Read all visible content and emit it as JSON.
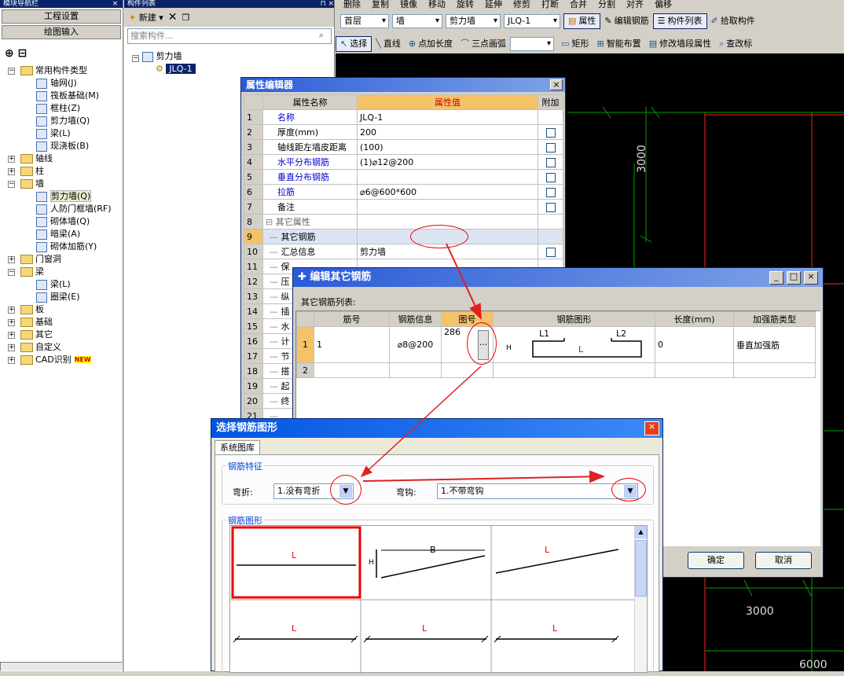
{
  "nav": {
    "title": "模块导航栏",
    "btn_project": "工程设置",
    "btn_draw": "绘图输入",
    "tree": [
      {
        "label": "常用构件类型",
        "level": 0,
        "type": "folder",
        "exp": "-"
      },
      {
        "label": "轴网(J)",
        "level": 1,
        "type": "item"
      },
      {
        "label": "筏板基础(M)",
        "level": 1,
        "type": "item"
      },
      {
        "label": "框柱(Z)",
        "level": 1,
        "type": "item"
      },
      {
        "label": "剪力墙(Q)",
        "level": 1,
        "type": "item"
      },
      {
        "label": "梁(L)",
        "level": 1,
        "type": "item"
      },
      {
        "label": "现浇板(B)",
        "level": 1,
        "type": "item"
      },
      {
        "label": "轴线",
        "level": 0,
        "type": "folder",
        "exp": "+"
      },
      {
        "label": "柱",
        "level": 0,
        "type": "folder",
        "exp": "+"
      },
      {
        "label": "墙",
        "level": 0,
        "type": "folder",
        "exp": "-"
      },
      {
        "label": "剪力墙(Q)",
        "level": 1,
        "type": "item",
        "sel": true
      },
      {
        "label": "人防门框墙(RF)",
        "level": 1,
        "type": "item"
      },
      {
        "label": "砌体墙(Q)",
        "level": 1,
        "type": "item"
      },
      {
        "label": "暗梁(A)",
        "level": 1,
        "type": "item"
      },
      {
        "label": "砌体加筋(Y)",
        "level": 1,
        "type": "item"
      },
      {
        "label": "门窗洞",
        "level": 0,
        "type": "folder",
        "exp": "+"
      },
      {
        "label": "梁",
        "level": 0,
        "type": "folder",
        "exp": "-"
      },
      {
        "label": "梁(L)",
        "level": 1,
        "type": "item"
      },
      {
        "label": "圈梁(E)",
        "level": 1,
        "type": "item"
      },
      {
        "label": "板",
        "level": 0,
        "type": "folder",
        "exp": "+"
      },
      {
        "label": "基础",
        "level": 0,
        "type": "folder",
        "exp": "+"
      },
      {
        "label": "其它",
        "level": 0,
        "type": "folder",
        "exp": "+"
      },
      {
        "label": "自定义",
        "level": 0,
        "type": "folder",
        "exp": "+"
      },
      {
        "label": "CAD识别",
        "level": 0,
        "type": "folder",
        "exp": "+",
        "badge": "NEW"
      }
    ]
  },
  "clist": {
    "title": "构件列表",
    "new_label": "新建",
    "search_placeholder": "搜索构件...",
    "root": "剪力墙",
    "child": "JLQ-1"
  },
  "toolbar0": [
    "删除",
    "复制",
    "镜像",
    "移动",
    "旋转",
    "延伸",
    "修剪",
    "打断",
    "合并",
    "分割",
    "对齐",
    "偏移"
  ],
  "toolbar1": {
    "floor": "首层",
    "cat": "墙",
    "type": "剪力墙",
    "comp": "JLQ-1",
    "btn_prop": "属性",
    "btn_edit": "编辑钢筋",
    "btn_list": "构件列表",
    "btn_pick": "拾取构件"
  },
  "toolbar2": [
    "选择",
    "直线",
    "点加长度",
    "三点画弧",
    "矩形",
    "智能布置",
    "修改墙段属性",
    "查改标"
  ],
  "cad": {
    "dim1": "3000",
    "dim2": "3000",
    "dim3": "6000"
  },
  "prop": {
    "title": "属性编辑器",
    "h_name": "属性名称",
    "h_val": "属性值",
    "h_add": "附加",
    "rows": [
      {
        "n": "1",
        "name": "名称",
        "val": "JLQ-1",
        "blue": true,
        "cb": false
      },
      {
        "n": "2",
        "name": "厚度(mm)",
        "val": "200",
        "blue": false,
        "cb": true
      },
      {
        "n": "3",
        "name": "轴线距左墙皮距离",
        "val": "(100)",
        "blue": false,
        "cb": true
      },
      {
        "n": "4",
        "name": "水平分布钢筋",
        "val": "(1)⌀12@200",
        "blue": true,
        "cb": true
      },
      {
        "n": "5",
        "name": "垂直分布钢筋",
        "val": "",
        "blue": true,
        "cb": true
      },
      {
        "n": "6",
        "name": "拉筋",
        "val": "⌀6@600*600",
        "blue": true,
        "cb": true
      },
      {
        "n": "7",
        "name": "备注",
        "val": "",
        "blue": false,
        "cb": true
      },
      {
        "n": "8",
        "name": "其它属性",
        "val": "",
        "blue": false,
        "cb": false,
        "group": true
      },
      {
        "n": "9",
        "name": "其它钢筋",
        "val": "",
        "blue": false,
        "cb": false,
        "sel": true
      },
      {
        "n": "10",
        "name": "汇总信息",
        "val": "剪力墙",
        "blue": false,
        "cb": true
      },
      {
        "n": "11",
        "name": "保",
        "val": "",
        "blue": false,
        "cb": false
      },
      {
        "n": "12",
        "name": "压",
        "val": "",
        "blue": false,
        "cb": false
      },
      {
        "n": "13",
        "name": "纵",
        "val": "",
        "blue": false,
        "cb": false
      },
      {
        "n": "14",
        "name": "插",
        "val": "",
        "blue": false,
        "cb": false
      },
      {
        "n": "15",
        "name": "水",
        "val": "",
        "blue": false,
        "cb": false
      },
      {
        "n": "16",
        "name": "计",
        "val": "",
        "blue": false,
        "cb": false
      },
      {
        "n": "17",
        "name": "节",
        "val": "",
        "blue": false,
        "cb": false
      },
      {
        "n": "18",
        "name": "搭",
        "val": "",
        "blue": false,
        "cb": false
      },
      {
        "n": "19",
        "name": "起",
        "val": "",
        "blue": false,
        "cb": false
      },
      {
        "n": "20",
        "name": "终",
        "val": "",
        "blue": false,
        "cb": false
      },
      {
        "n": "21",
        "name": "",
        "val": "",
        "blue": false,
        "cb": false
      }
    ]
  },
  "other": {
    "title": "编辑其它钢筋",
    "list_label": "其它钢筋列表:",
    "headers": [
      "筋号",
      "钢筋信息",
      "图号",
      "钢筋图形",
      "长度(mm)",
      "加强筋类型"
    ],
    "row1": {
      "n": "1",
      "no": "1",
      "info": "⌀8@200",
      "fig": "286",
      "btn": "...",
      "len": "0",
      "type": "垂直加强筋"
    },
    "row2": {
      "n": "2"
    },
    "shape_l1": "L1",
    "shape_l2": "L2",
    "shape_l": "L",
    "shape_h": "H",
    "ok": "确定",
    "cancel": "取消"
  },
  "select": {
    "title": "选择钢筋图形",
    "tab": "系统图库",
    "feature": "钢筋特征",
    "bend_label": "弯折:",
    "bend_val": "1.没有弯折",
    "hook_label": "弯钩:",
    "hook_val": "1.不带弯钩",
    "shape_group": "钢筋图形",
    "cell_l": "L",
    "cell_b": "B",
    "cell_h": "H"
  },
  "colors": {
    "grid_green": "#00a000",
    "red": "#ff2020",
    "titlebar": "#2a5bd7"
  }
}
